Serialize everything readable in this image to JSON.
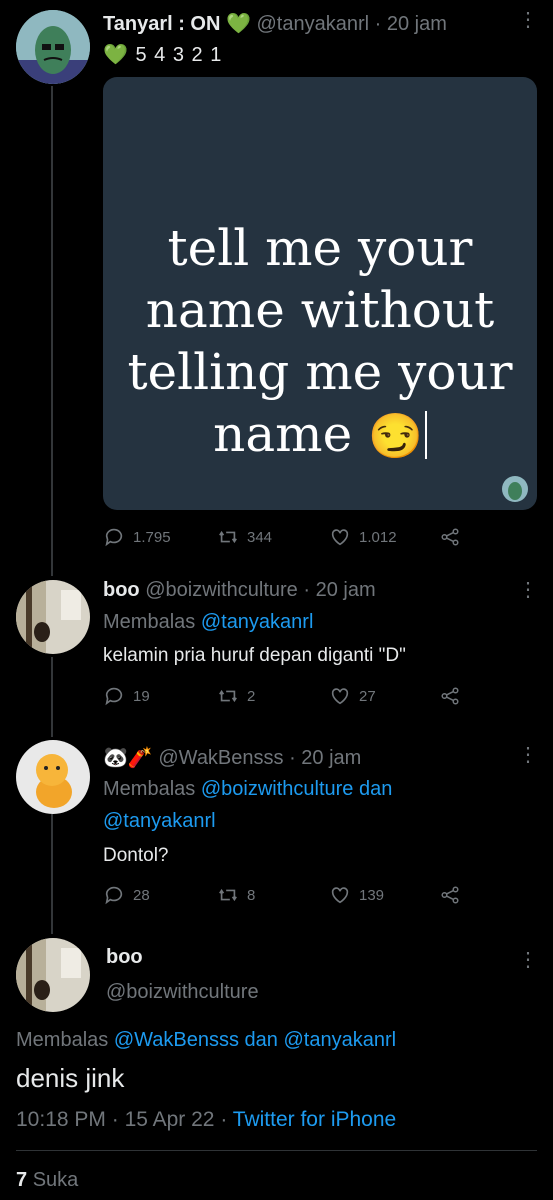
{
  "tweets": [
    {
      "display_name": "Tanyarl : ON",
      "name_emoji": "💚",
      "handle": "@tanyakanrl",
      "time": "· 20 jam",
      "bio_line": "5 4 3 2 1",
      "bio_emoji": "💚",
      "media_text_lines": [
        "tell me your",
        "name without",
        "telling me your",
        "name"
      ],
      "media_emoji": "😏",
      "stats": {
        "replies": "1.795",
        "retweets": "344",
        "likes": "1.012"
      }
    },
    {
      "display_name": "boo",
      "handle": "@boizwithculture",
      "time": "· 20 jam",
      "replying_prefix": "Membalas",
      "replying_to": "@tanyakanrl",
      "text": "kelamin pria huruf depan diganti \"D\"",
      "stats": {
        "replies": "19",
        "retweets": "2",
        "likes": "27"
      }
    },
    {
      "display_name_emoji": "🐼🧨",
      "handle": "@WakBensss",
      "time": "· 20 jam",
      "replying_prefix": "Membalas",
      "replying_to": "@boizwithculture",
      "replying_joiner": "dan",
      "replying_to_2": "@tanyakanrl",
      "text": "Dontol?",
      "stats": {
        "replies": "28",
        "retweets": "8",
        "likes": "139"
      }
    }
  ],
  "focused": {
    "display_name": "boo",
    "handle": "@boizwithculture",
    "replying_prefix": "Membalas",
    "replying_to": "@WakBensss",
    "replying_joiner": "dan",
    "replying_to_2": "@tanyakanrl",
    "text": "denis jink",
    "time": "10:18 PM",
    "separator": "·",
    "date": "15 Apr 22",
    "source": "Twitter for iPhone",
    "likes_count": "7",
    "likes_label": "Suka"
  },
  "colors": {
    "background": "#000000",
    "link": "#1d9bf0",
    "muted": "#71767b",
    "like_heart": "#00ba7c"
  }
}
